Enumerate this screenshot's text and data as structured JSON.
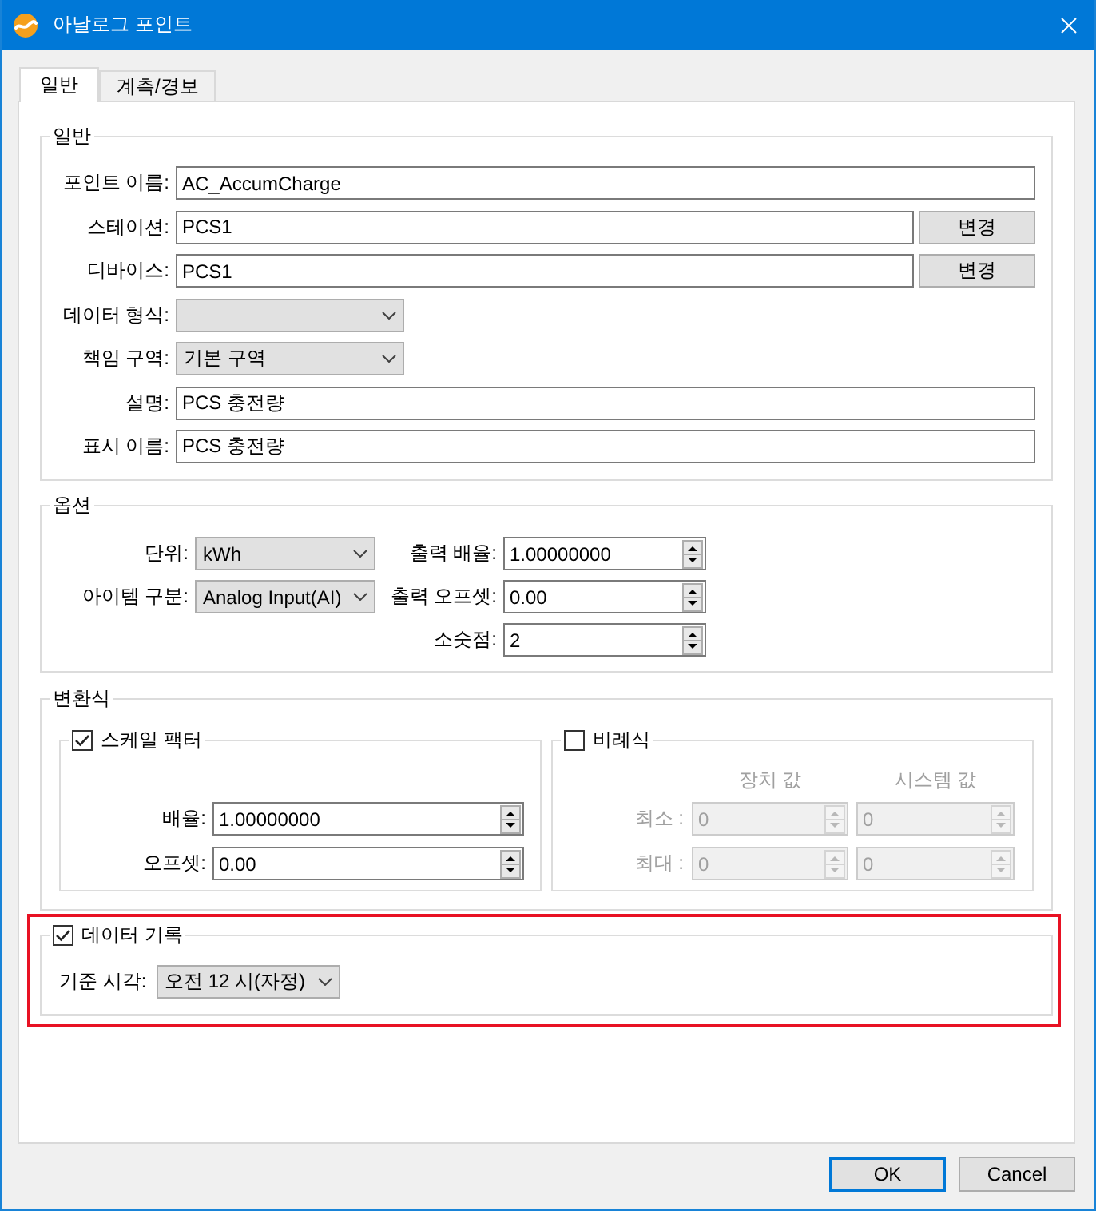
{
  "window": {
    "title": "아날로그 포인트"
  },
  "tabs": [
    {
      "label": "일반",
      "selected": true
    },
    {
      "label": "계측/경보",
      "selected": false
    }
  ],
  "general": {
    "title": "일반",
    "fields": [
      {
        "kind": "text",
        "label": "포인트 이름:",
        "value": "AC_AccumCharge"
      },
      {
        "kind": "text_button",
        "label": "스테이션:",
        "value": "PCS1",
        "button": "변경"
      },
      {
        "kind": "text_button",
        "label": "디바이스:",
        "value": "PCS1",
        "button": "변경"
      },
      {
        "kind": "combo",
        "label": "데이터 형식:"
      },
      {
        "kind": "combo",
        "label": "책임 구역:",
        "value": "기본 구역"
      },
      {
        "kind": "text",
        "label": "설명:",
        "value": "PCS 충전량"
      },
      {
        "kind": "text",
        "label": "표시 이름:",
        "value": "PCS 충전량"
      }
    ]
  },
  "options": {
    "title": "옵션",
    "combos": [
      {
        "label": "단위:",
        "value": "kWh"
      },
      {
        "label": "아이템 구분:",
        "value": "Analog Input(AI)"
      }
    ],
    "spinners": [
      {
        "label": "출력 배율:",
        "value": "1.00000000"
      },
      {
        "label": "출력 오프셋:",
        "value": "0.00"
      },
      {
        "label": "소숫점:",
        "value": "2"
      }
    ]
  },
  "conversion": {
    "title": "변환식",
    "scale_factor": {
      "title": "스케일 팩터",
      "checked": true,
      "fields": [
        {
          "label": "배율:",
          "value": "1.00000000"
        },
        {
          "label": "오프셋:",
          "value": "0.00"
        }
      ]
    },
    "proportional": {
      "title": "비례식",
      "checked": false,
      "columns": [
        "장치 값",
        "시스템 값"
      ],
      "rows": [
        {
          "label": "최소 :",
          "values": [
            "0",
            "0"
          ]
        },
        {
          "label": "최대 :",
          "values": [
            "0",
            "0"
          ]
        }
      ]
    }
  },
  "data_logging": {
    "title": "데이터 기록",
    "checked": true,
    "highlighted": true,
    "base_time": {
      "label": "기준 시각:",
      "value": "오전 12 시(자정)"
    }
  },
  "buttons": [
    {
      "label": "OK",
      "default": true
    },
    {
      "label": "Cancel",
      "default": false
    }
  ]
}
